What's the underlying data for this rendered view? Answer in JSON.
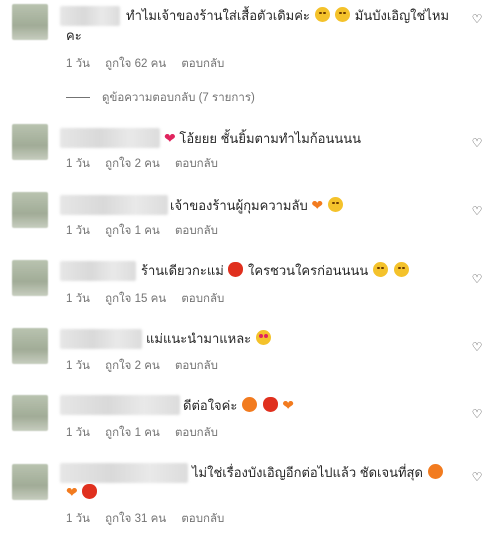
{
  "comments": [
    {
      "text": "ทำไมเจ้าของร้านใส่เสื้อตัวเดิมค่ะ",
      "text_after": "มันบังเอิญใช่ไหม",
      "text_line2": "คะ",
      "time": "1 วัน",
      "likes": "ถูกใจ 62 คน",
      "reply": "ตอบกลับ"
    },
    {
      "text": "โอ้ยยย ชั้นยิ้มตามทำไมก้อนนนน",
      "time": "1 วัน",
      "likes": "ถูกใจ 2 คน",
      "reply": "ตอบกลับ"
    },
    {
      "text": "เจ้าของร้านผู้กุมความลับ",
      "time": "1 วัน",
      "likes": "ถูกใจ 1 คน",
      "reply": "ตอบกลับ"
    },
    {
      "text": "ร้านเดียวกะแม่",
      "text_after": "ใครชวนใครก่อนนนน",
      "time": "1 วัน",
      "likes": "ถูกใจ 15 คน",
      "reply": "ตอบกลับ"
    },
    {
      "text": "แม่แนะนำมาแหละ",
      "time": "1 วัน",
      "likes": "ถูกใจ 2 คน",
      "reply": "ตอบกลับ"
    },
    {
      "text": "ดีต่อใจค่ะ",
      "time": "1 วัน",
      "likes": "ถูกใจ 1 คน",
      "reply": "ตอบกลับ"
    },
    {
      "text": "ไม่ใช่เรื่องบังเอิญอีกต่อไปแล้ว ชัดเจนที่สุด",
      "time": "1 วัน",
      "likes": "ถูกใจ 31 คน",
      "reply": "ตอบกลับ"
    }
  ],
  "view_replies": "ดูข้อความตอบกลับ (7 รายการ)",
  "icons": {
    "like": "heart-outline-icon",
    "emoji": [
      "rofl-face",
      "grin-face",
      "red-heart",
      "orange-heart",
      "smirk-face",
      "apple",
      "peach",
      "heart-eyes-face"
    ]
  }
}
